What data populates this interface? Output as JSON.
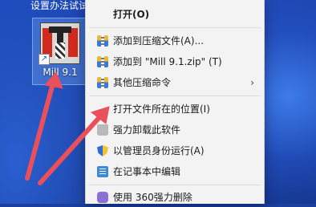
{
  "desktop": {
    "top_text": "设置办法试试",
    "icon": {
      "label": "Mill 9.1",
      "shortcut_glyph": "↗"
    }
  },
  "menu": {
    "items": [
      {
        "label": "打开(O)",
        "icon": ""
      },
      {
        "label": "添加到压缩文件(A)...",
        "icon": "zip-icon"
      },
      {
        "label": "添加到 \"Mill 9.1.zip\" (T)",
        "icon": "zip-icon"
      },
      {
        "label": "其他压缩命令",
        "icon": "zip-icon",
        "submenu": true
      },
      {
        "label": "打开文件所在的位置(I)",
        "icon": ""
      },
      {
        "label": "强力卸载此软件",
        "icon": "trash-icon"
      },
      {
        "label": "以管理员身份运行(A)",
        "icon": "shield-icon"
      },
      {
        "label": "在记事本中编辑",
        "icon": "notepad-icon"
      },
      {
        "label": "使用 360强力删除",
        "icon": "360-icon"
      }
    ],
    "submenu_glyph": "›"
  },
  "colors": {
    "arrow": "#e8505b",
    "menu_bg": "#f3f3f3",
    "accent": "#2b6fd6"
  }
}
